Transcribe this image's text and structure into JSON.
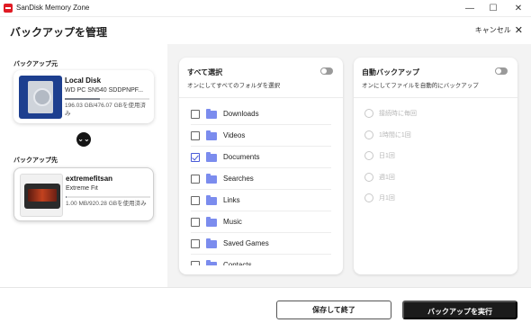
{
  "window": {
    "title": "SanDisk Memory Zone",
    "minimize_glyph": "—",
    "maximize_glyph": "☐",
    "close_glyph": "✕"
  },
  "header": {
    "title": "バックアップを管理",
    "cancel_label": "キャンセル",
    "cancel_icon": "✕"
  },
  "source": {
    "label": "バックアップ元",
    "name": "Local Disk",
    "model": "WD PC SN540 SDDPNPF...",
    "usage_text": "196.03 GB/476.07 GBを使用済み",
    "usage_fraction": 0.41,
    "icon": "hdd-icon"
  },
  "arrow": {
    "glyph": "⌄⌄",
    "icon": "double-chevron-down-icon"
  },
  "destination": {
    "label": "バックアップ先",
    "name": "extremefitsan",
    "model": "Extreme Fit",
    "usage_text": "1.00 MB/920.28 GBを使用済み",
    "usage_fraction": 0.01,
    "icon": "ssd-icon"
  },
  "folders_card": {
    "title": "すべて選択",
    "subtitle": "オンにしてすべてのフォルダを選択",
    "toggle_on": false,
    "items": [
      {
        "label": "Downloads",
        "checked": false
      },
      {
        "label": "Videos",
        "checked": false
      },
      {
        "label": "Documents",
        "checked": true
      },
      {
        "label": "Searches",
        "checked": false
      },
      {
        "label": "Links",
        "checked": false
      },
      {
        "label": "Music",
        "checked": false
      },
      {
        "label": "Saved Games",
        "checked": false
      },
      {
        "label": "Contacts",
        "checked": false
      }
    ]
  },
  "auto_card": {
    "title": "自動バックアップ",
    "subtitle": "オンにしてファイルを自動的にバックアップ",
    "toggle_on": false,
    "options": [
      {
        "label": "接続時に毎回"
      },
      {
        "label": "1時間に1回"
      },
      {
        "label": "日1回"
      },
      {
        "label": "週1回"
      },
      {
        "label": "月1回"
      }
    ]
  },
  "footer": {
    "save_label": "保存して終了",
    "run_label": "バックアップを実行"
  },
  "colors": {
    "accent": "#4a5bd8",
    "folder": "#7b8cee",
    "primary_button": "#1b1b1b",
    "brand": "#e01b24"
  }
}
